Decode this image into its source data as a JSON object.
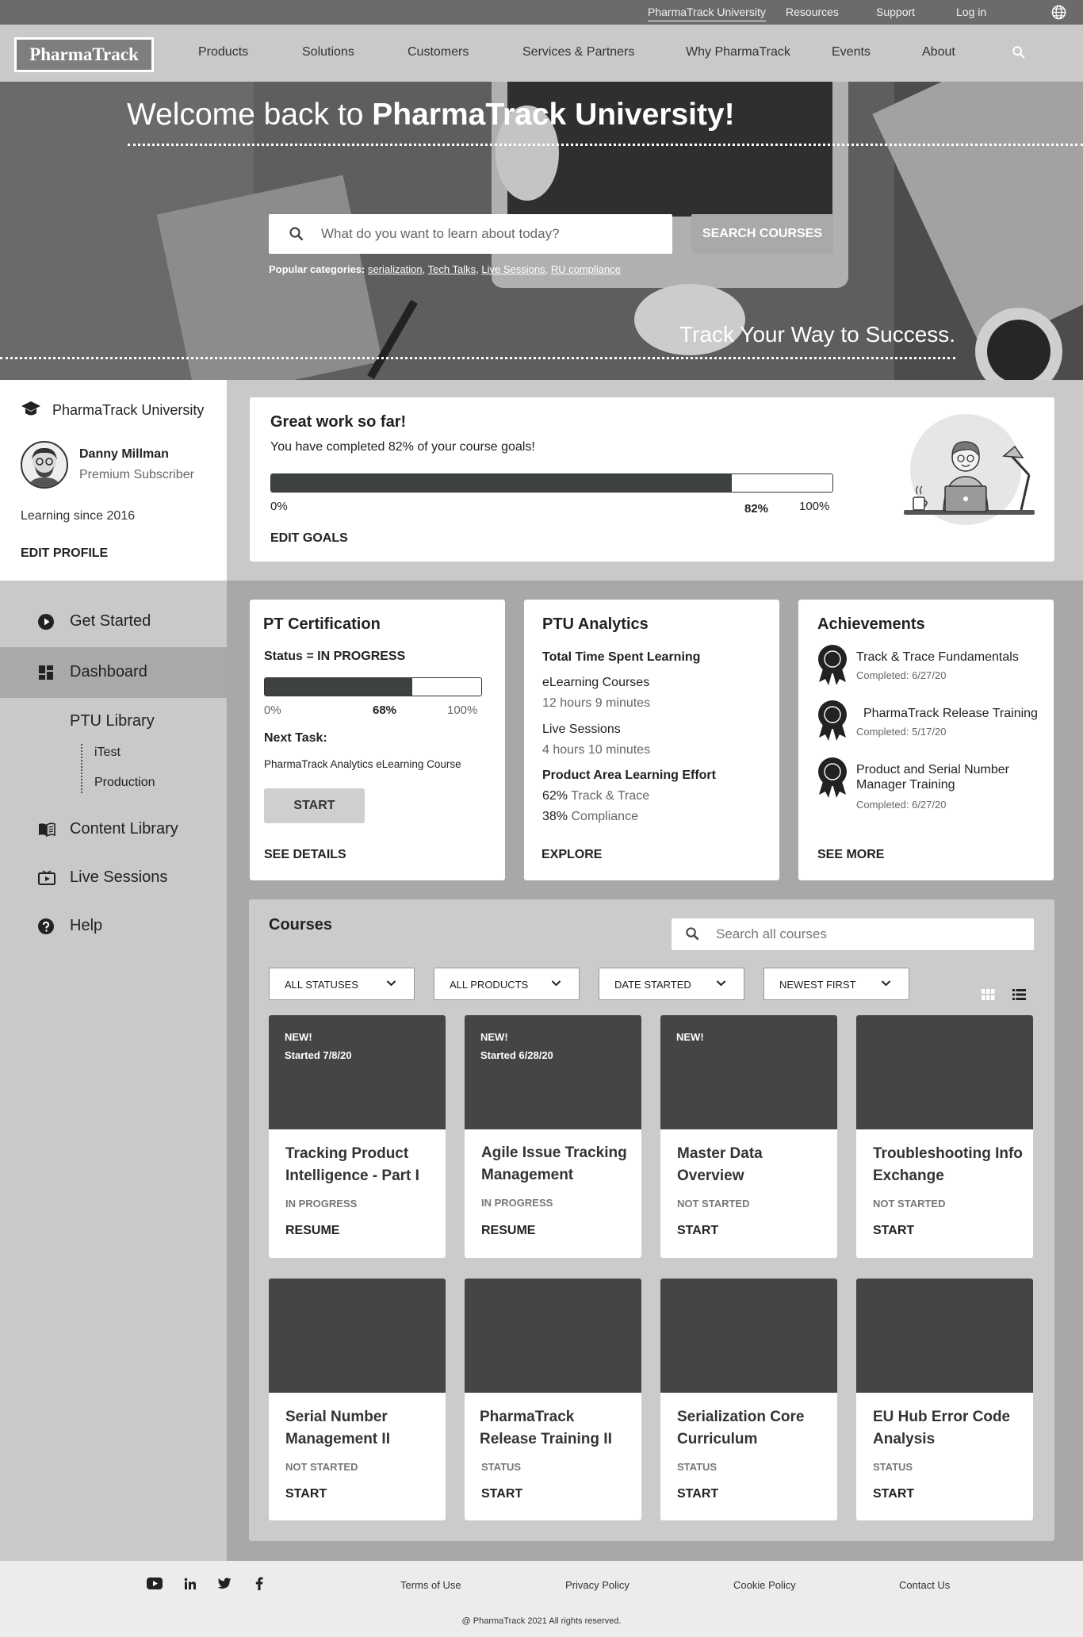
{
  "topbar": {
    "links": [
      "PharmaTrack University",
      "Resources",
      "Support",
      "Log in"
    ]
  },
  "navbar": {
    "logo": "PharmaTrack",
    "items": [
      "Products",
      "Solutions",
      "Customers",
      "Services & Partners",
      "Why PharmaTrack",
      "Events",
      "About"
    ]
  },
  "hero": {
    "title_prefix": "Welcome back to ",
    "title_bold": "PharmaTrack University!",
    "search_placeholder": "What do you want to learn about today?",
    "search_button": "SEARCH COURSES",
    "popular_label": "Popular categories:",
    "popular_items": [
      "serialization",
      "Tech Talks",
      "Live Sessions",
      "RU compliance"
    ],
    "tagline": "Track Your Way to Success."
  },
  "profile": {
    "university": "PharmaTrack University",
    "name": "Danny Millman",
    "tier": "Premium Subscriber",
    "since": "Learning since 2016",
    "edit": "EDIT PROFILE"
  },
  "sidebar": {
    "items": [
      "Get Started",
      "Dashboard",
      "PTU Library",
      "Content Library",
      "Live Sessions",
      "Help"
    ],
    "library_sub": [
      "iTest",
      "Production"
    ]
  },
  "goals": {
    "title": "Great work so far!",
    "text": "You have completed 82% of your course goals!",
    "progress": 82,
    "min": "0%",
    "value_label": "82%",
    "max": "100%",
    "edit": "EDIT GOALS"
  },
  "cert": {
    "title": "PT Certification",
    "status": "Status = IN PROGRESS",
    "progress": 68,
    "min": "0%",
    "value_label": "68%",
    "max": "100%",
    "next_label": "Next Task:",
    "next_task": "PharmaTrack Analytics eLearning Course",
    "start": "START",
    "details": "SEE DETAILS"
  },
  "analytics": {
    "title": "PTU Analytics",
    "total_label": "Total Time Spent Learning",
    "elearning_label": "eLearning Courses",
    "elearning_value": "12 hours 9 minutes",
    "live_label": "Live Sessions",
    "live_value": "4 hours 10 minutes",
    "effort_label": "Product Area Learning Effort",
    "effort": [
      {
        "pct": "62%",
        "area": "Track & Trace"
      },
      {
        "pct": "38%",
        "area": "Compliance"
      }
    ],
    "explore": "EXPLORE"
  },
  "achievements": {
    "title": "Achievements",
    "items": [
      {
        "name": "Track & Trace Fundamentals",
        "date": "Completed: 6/27/20"
      },
      {
        "name": "PharmaTrack Release Training",
        "date": "Completed: 5/17/20"
      },
      {
        "name": "Product and Serial Number Manager Training",
        "date": "Completed: 6/27/20"
      }
    ],
    "more": "SEE MORE"
  },
  "courses": {
    "title": "Courses",
    "search_placeholder": "Search all courses",
    "filters": [
      "ALL STATUSES",
      "ALL PRODUCTS",
      "DATE STARTED",
      "NEWEST FIRST"
    ],
    "cards": [
      {
        "new": "NEW!",
        "started": "Started 7/8/20",
        "title": "Tracking Product Intelligence - Part I",
        "status": "IN PROGRESS",
        "action": "RESUME"
      },
      {
        "new": "NEW!",
        "started": "Started 6/28/20",
        "title": "Agile Issue Tracking Management",
        "status": "IN PROGRESS",
        "action": "RESUME"
      },
      {
        "new": "NEW!",
        "started": "",
        "title": "Master Data Overview",
        "status": "NOT STARTED",
        "action": "START"
      },
      {
        "new": "",
        "started": "",
        "title": "Troubleshooting Info Exchange",
        "status": "NOT STARTED",
        "action": "START"
      },
      {
        "new": "",
        "started": "",
        "title": "Serial Number Management II",
        "status": "NOT STARTED",
        "action": "START"
      },
      {
        "new": "",
        "started": "",
        "title": "PharmaTrack Release Training II",
        "status": "STATUS",
        "action": "START"
      },
      {
        "new": "",
        "started": "",
        "title": "Serialization Core Curriculum",
        "status": "STATUS",
        "action": "START"
      },
      {
        "new": "",
        "started": "",
        "title": "EU Hub Error Code Analysis",
        "status": "STATUS",
        "action": "START"
      }
    ]
  },
  "footer": {
    "links": [
      "Terms of Use",
      "Privacy Policy",
      "Cookie Policy",
      "Contact Us"
    ],
    "copyright": "@ PharmaTrack 2021 All rights reserved."
  },
  "colors": {
    "topbar": "#6b6b6b",
    "navbar": "#c9c9c9",
    "progress_fill": "#3e4142",
    "course_image": "#454545"
  }
}
